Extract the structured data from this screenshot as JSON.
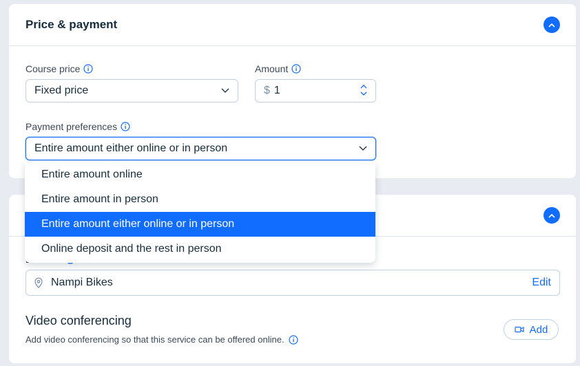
{
  "price_section": {
    "title": "Price & payment",
    "course_price": {
      "label": "Course price",
      "value": "Fixed price"
    },
    "amount": {
      "label": "Amount",
      "currency": "$",
      "value": "1"
    },
    "payment_preferences": {
      "label": "Payment preferences",
      "value": "Entire amount either online or in person",
      "options": [
        "Entire amount online",
        "Entire amount in person",
        "Entire amount either online or in person",
        "Online deposit and the rest in person"
      ],
      "selected_index": 2
    }
  },
  "location_section": {
    "location_label": "Location",
    "location_value": "Nampi Bikes",
    "edit_label": "Edit",
    "video": {
      "title": "Video conferencing",
      "description": "Add video conferencing so that this service can be offered online.",
      "add_label": "Add"
    }
  },
  "colors": {
    "accent": "#116dff",
    "background": "#e8ebf1",
    "border": "#c1d2e5",
    "text": "#162d3d"
  },
  "icons": [
    "info-icon",
    "chevron-down-icon",
    "chevron-up-icon",
    "map-pin-icon",
    "video-camera-icon"
  ]
}
